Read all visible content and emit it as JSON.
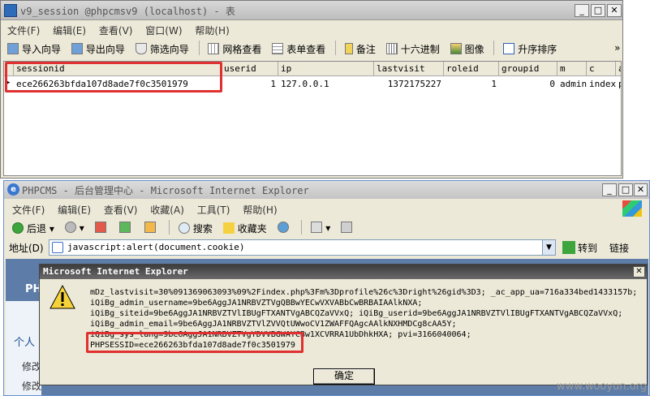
{
  "navicat": {
    "title": "v9_session @phpcmsv9 (localhost) - 表",
    "menu": [
      "文件(F)",
      "编辑(E)",
      "查看(V)",
      "窗口(W)",
      "帮助(H)"
    ],
    "toolbar": {
      "import": "导入向导",
      "export": "导出向导",
      "filter": "筛选向导",
      "grid_view": "网格查看",
      "form_view": "表单查看",
      "memo": "备注",
      "hex": "十六进制",
      "image": "图像",
      "sort": "升序排序",
      "more": "»"
    },
    "columns": [
      "sessionid",
      "userid",
      "ip",
      "lastvisit",
      "roleid",
      "groupid",
      "m",
      "c",
      "a"
    ],
    "row": {
      "sessionid": "ece266263bfda107d8ade7f0c3501979",
      "userid": "1",
      "ip": "127.0.0.1",
      "lastvisit": "1372175227",
      "roleid": "1",
      "groupid": "0",
      "m": "admin",
      "c": "index",
      "a": "p"
    }
  },
  "ie": {
    "title": "PHPCMS - 后台管理中心 - Microsoft Internet Explorer",
    "menu": [
      "文件(F)",
      "编辑(E)",
      "查看(V)",
      "收藏(A)",
      "工具(T)",
      "帮助(H)"
    ],
    "toolbar": {
      "back": "后退",
      "search": "搜索",
      "favorites": "收藏夹"
    },
    "address_label": "地址(D)",
    "address": "javascript:alert(document.cookie)",
    "go": "转到",
    "links": "链接",
    "sidebar": {
      "brand": "PH",
      "personal": "个人",
      "item1": "修改",
      "item2": "修改"
    }
  },
  "alert": {
    "title": "Microsoft Internet Explorer",
    "lines": [
      "mDz_lastvisit=30%091369063093%09%2Findex.php%3Fm%3Dprofile%26c%3Dright%26gid%3D3; _ac_app_ua=716a334bed1433157b;",
      "iQiBg_admin_username=9be6AggJA1NRBVZTVgQBBwYECwVXVABbCwBRBAIAAlkNXA;",
      "iQiBg_siteid=9be6AggJA1NRBVZTVlIBUgFTXANTVgABCQZaVVxQ; iQiBg_userid=9be6AggJA1NRBVZTVlIBUgFTXANTVgABCQZaVVxQ;",
      "iQiBg_admin_email=9be6AggJA1NRBVZTVlZVVQtUWwoCV1ZWAFFQAgcAAlkNXHMDCg8cAA5Y;",
      "iQiBg_sys_lang=9be6AggJA1NRBVZTVgYDVVBGWAYCBw1XCVRRA1UbDhkHXA; pvi=3166040064;"
    ],
    "phpsessid": "PHPSESSID=ece266263bfda107d8ade7f0c3501979",
    "ok": "确定"
  },
  "watermark": "www.wooyun.org"
}
